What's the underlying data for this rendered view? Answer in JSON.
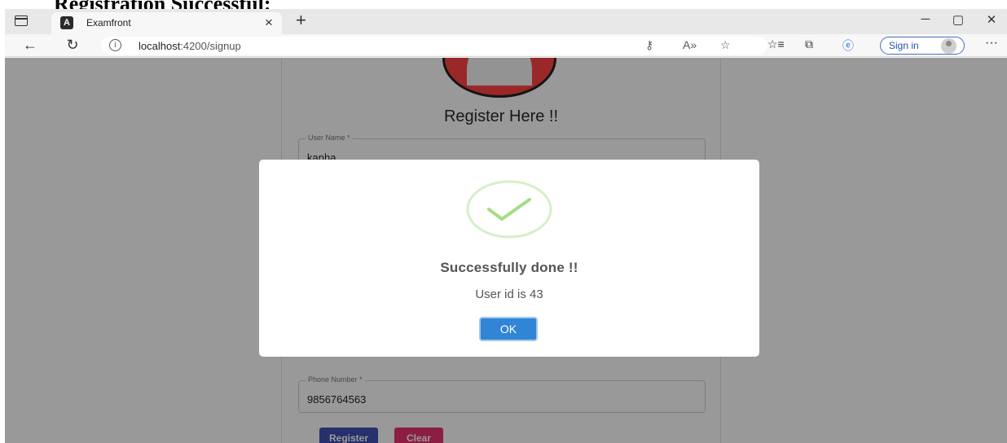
{
  "caption": "Registration Successful:",
  "browser": {
    "tab_title": "Examfront",
    "favicon_letter": "A",
    "close_glyph": "×",
    "newtab_glyph": "+",
    "url_host": "localhost",
    "url_path": ":4200/signup",
    "signin_label": "Sign in",
    "more_glyph": "···"
  },
  "form": {
    "title": "Register Here !!",
    "fields": [
      {
        "label": "User Name *",
        "value": "kanha"
      },
      {
        "label": "Phone Number *",
        "value": "9856764563"
      }
    ],
    "register_label": "Register",
    "clear_label": "Clear",
    "colors": {
      "register": "#3f51b5",
      "clear": "#e8336f"
    }
  },
  "modal": {
    "title": "Successfully done !!",
    "text": "User id is 43",
    "ok_label": "OK",
    "colors": {
      "ok": "#3085d6",
      "success": "#a5dc86"
    }
  }
}
